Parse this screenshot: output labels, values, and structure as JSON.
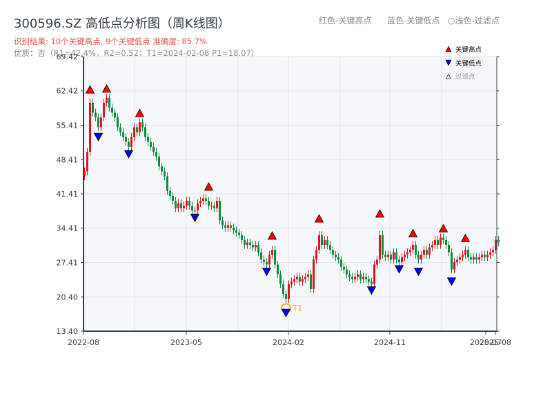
{
  "header": {
    "title": "300596.SZ 高低点分析图（周K线图）",
    "result": "识别结果: 10个关键高点, 9个关键低点  准确度: 85.7%",
    "quality": "优质：否（R1=42.4%，R2=0.52；T1=2024-02-08 P1=18.07）",
    "hint_red": "红色-关键高点",
    "hint_blue": "蓝色-关键低点",
    "hint_light": "○浅色-过滤点"
  },
  "colors": {
    "up": "#e0141e",
    "down": "#0e8a3c",
    "high_marker": "#ff0000",
    "low_marker": "#0000ff",
    "t1": "#f5a623",
    "plot_bg": "#f5f7fa"
  },
  "chart_data": {
    "type": "candlestick",
    "ylim": [
      13.4,
      69.42
    ],
    "yticks": [
      "69.42",
      "62.42",
      "55.41",
      "48.41",
      "41.41",
      "34.41",
      "27.41",
      "20.40",
      "13.40"
    ],
    "xticks": [
      "2022-08",
      "2023-05",
      "2024-02",
      "2024-11",
      "2025-07",
      "2025-08"
    ],
    "grid": true,
    "legend_position": "top-right",
    "legend": [
      "关键高点",
      "关键低点",
      "过滤点"
    ],
    "first_open": 45,
    "weekly_close": [
      46,
      50,
      60,
      58,
      57,
      55,
      57,
      60,
      61,
      59,
      58,
      57,
      55,
      54,
      53,
      52,
      51,
      53,
      55,
      54,
      56,
      55,
      53,
      52,
      51,
      50,
      49,
      47,
      46,
      45,
      42,
      41,
      40,
      38.5,
      39.5,
      38.5,
      39,
      40,
      39,
      38,
      38,
      39.5,
      40,
      40.5,
      40,
      39,
      39,
      38.5,
      40,
      36,
      35,
      34.5,
      35,
      34.5,
      34,
      33.5,
      33,
      32,
      31,
      31.5,
      31,
      30.5,
      31,
      29.5,
      28,
      27.5,
      27,
      29,
      30,
      27,
      25,
      23,
      21,
      20,
      23,
      23.5,
      24,
      24.5,
      23.5,
      24,
      24.5,
      25,
      22,
      28,
      30,
      33,
      31,
      32,
      31,
      30,
      29,
      28.5,
      28,
      26.5,
      26,
      25,
      24.5,
      24,
      24.5,
      25,
      24,
      24.5,
      24,
      23.5,
      23,
      27,
      28,
      33,
      29,
      28.5,
      29,
      28,
      29.5,
      28,
      27.5,
      28.5,
      29,
      29.5,
      30,
      31,
      29,
      28,
      29,
      30,
      29,
      30.5,
      31,
      32,
      31,
      32.5,
      32,
      31,
      29.5,
      26,
      27.5,
      28,
      28.5,
      29,
      30,
      28.5,
      28,
      28.5,
      28,
      28.5,
      29,
      28.5,
      29,
      29.5,
      30,
      32,
      31.5
    ],
    "key_highs": [
      {
        "week": 2,
        "price": 61.8
      },
      {
        "week": 8,
        "price": 62
      },
      {
        "week": 20,
        "price": 57
      },
      {
        "week": 45,
        "price": 42
      },
      {
        "week": 68,
        "price": 32
      },
      {
        "week": 85,
        "price": 35.5
      },
      {
        "week": 107,
        "price": 36.5
      },
      {
        "week": 119,
        "price": 32.5
      },
      {
        "week": 130,
        "price": 33.5
      },
      {
        "week": 138,
        "price": 31.5
      }
    ],
    "key_lows": [
      {
        "week": 5,
        "price": 53.5
      },
      {
        "week": 16,
        "price": 50
      },
      {
        "week": 40,
        "price": 37
      },
      {
        "week": 66,
        "price": 26
      },
      {
        "week": 73,
        "price": 17.6
      },
      {
        "week": 104,
        "price": 22.2
      },
      {
        "week": 114,
        "price": 26.5
      },
      {
        "week": 121,
        "price": 26
      },
      {
        "week": 133,
        "price": 24
      }
    ],
    "t1": {
      "label": "T1",
      "week": 73,
      "price": 18.07
    }
  }
}
